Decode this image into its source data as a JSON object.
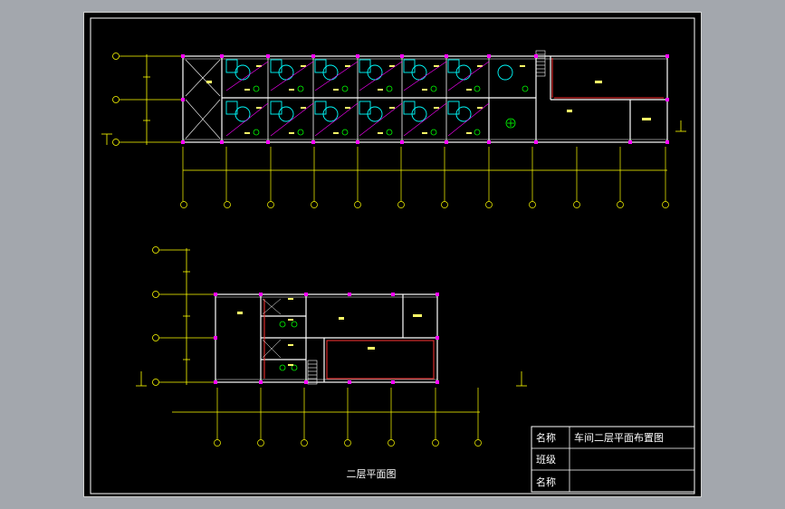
{
  "drawing": {
    "caption": "二层平面图",
    "title_block": {
      "row1_label": "名称",
      "row1_value": "车间二层平面布置图",
      "row2_label": "班级",
      "row2_value": "",
      "row3_label": "名称",
      "row3_value": ""
    }
  },
  "colors": {
    "background": "#000000",
    "wall": "#ffffff",
    "dimension": "#ffff00",
    "equipment": "#00ffff",
    "marker": "#ff00ff",
    "annotation": "#00ff00",
    "window_frame": "#a3a7ad"
  }
}
